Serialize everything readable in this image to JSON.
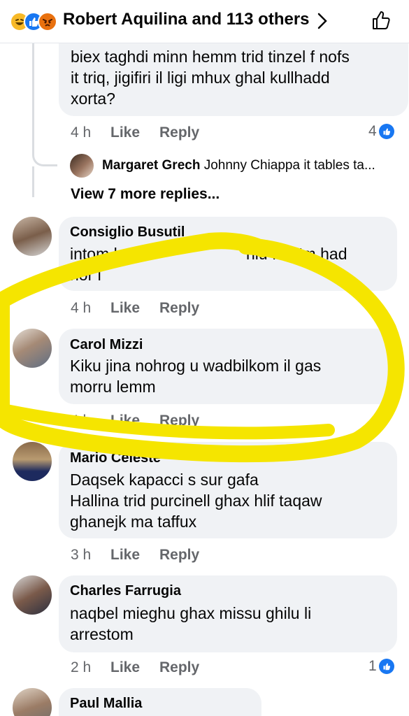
{
  "header": {
    "title": "Robert Aquilina and 113 others",
    "reactions": [
      "haha-icon",
      "like-icon",
      "angry-icon"
    ],
    "chevron_icon": "chevron-right-icon",
    "like_icon": "thumbs-up-icon"
  },
  "comments": [
    {
      "name": "",
      "lines": [
        "biex taghdi minn hemm trid tinzel f nofs",
        "it triq, jigifiri il ligi mhux ghal kullhadd",
        "xorta?"
      ],
      "time": "4 h",
      "like": "Like",
      "reply": "Reply",
      "reactions": "4"
    },
    {
      "name": "Consiglio Busutil",
      "lines": [
        "intom l",
        "hlu fso#m had",
        "nor l"
      ],
      "time": "4 h",
      "like": "Like",
      "reply": "Reply"
    },
    {
      "name": "Carol Mizzi",
      "lines": [
        "Kiku jina nohrog u wadbilkom il gas",
        "morru lemm"
      ],
      "time": "4 h",
      "like": "Like",
      "reply": "Reply"
    },
    {
      "name": "Mario Celeste",
      "lines": [
        "Daqsek kapacci s sur gafa",
        "Hallina trid purcinell ghax hlif taqaw",
        "ghanejk ma taffux"
      ],
      "time": "3 h",
      "like": "Like",
      "reply": "Reply"
    },
    {
      "name": "Charles Farrugia",
      "lines": [
        "naqbel mieghu ghax missu ghilu li",
        "arrestom"
      ],
      "time": "2 h",
      "like": "Like",
      "reply": "Reply",
      "reactions": "1"
    },
    {
      "name": "Paul Mallia"
    }
  ],
  "reply_preview": {
    "name": "Margaret Grech",
    "text": "Johnny Chiappa it tables ta..."
  },
  "view_more": "View 7 more replies...",
  "colors": {
    "bubble": "#f0f2f5",
    "meta": "#65676b",
    "accent": "#1877f2",
    "highlight": "#f5e500"
  }
}
